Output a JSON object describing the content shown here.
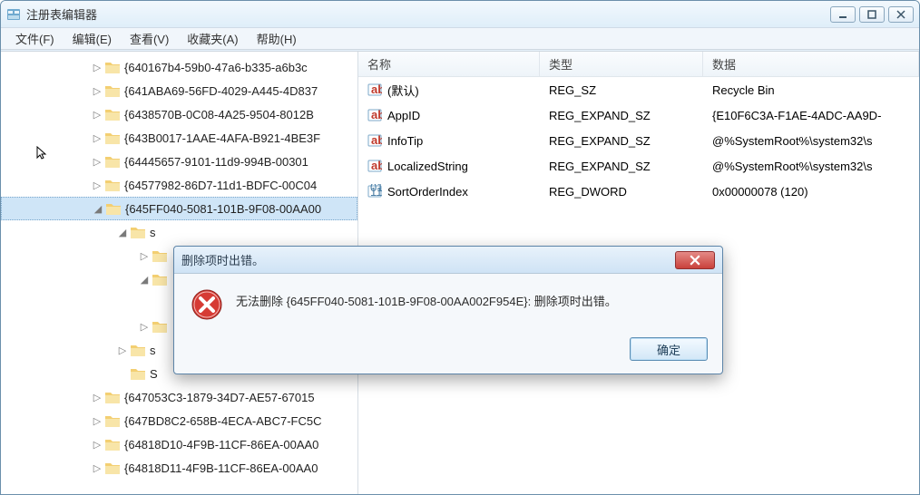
{
  "window": {
    "title": "注册表编辑器"
  },
  "menu": {
    "file": "文件(F)",
    "edit": "编辑(E)",
    "view": "查看(V)",
    "favorites": "收藏夹(A)",
    "help": "帮助(H)"
  },
  "tree": {
    "items": [
      {
        "indent": 100,
        "toggle": "▷",
        "label": "{640167b4-59b0-47a6-b335-a6b3c",
        "selected": false
      },
      {
        "indent": 100,
        "toggle": "▷",
        "label": "{641ABA69-56FD-4029-A445-4D837",
        "selected": false
      },
      {
        "indent": 100,
        "toggle": "▷",
        "label": "{6438570B-0C08-4A25-9504-8012B",
        "selected": false
      },
      {
        "indent": 100,
        "toggle": "▷",
        "label": "{643B0017-1AAE-4AFA-B921-4BE3F",
        "selected": false
      },
      {
        "indent": 100,
        "toggle": "▷",
        "label": "{64445657-9101-11d9-994B-00301",
        "selected": false
      },
      {
        "indent": 100,
        "toggle": "▷",
        "label": "{64577982-86D7-11d1-BDFC-00C04",
        "selected": false
      },
      {
        "indent": 100,
        "toggle": "◢",
        "label": "{645FF040-5081-101B-9F08-00AA00",
        "selected": true
      },
      {
        "indent": 128,
        "toggle": "◢",
        "label": "s",
        "selected": false
      },
      {
        "indent": 152,
        "toggle": "▷",
        "label": "",
        "selected": false
      },
      {
        "indent": 152,
        "toggle": "◢",
        "label": "",
        "selected": false
      },
      {
        "indent": 176,
        "toggle": "",
        "label": "",
        "selected": false
      },
      {
        "indent": 152,
        "toggle": "▷",
        "label": "",
        "selected": false
      },
      {
        "indent": 128,
        "toggle": "▷",
        "label": "s",
        "selected": false
      },
      {
        "indent": 128,
        "toggle": "",
        "label": "S",
        "selected": false
      },
      {
        "indent": 100,
        "toggle": "▷",
        "label": "{647053C3-1879-34D7-AE57-67015",
        "selected": false
      },
      {
        "indent": 100,
        "toggle": "▷",
        "label": "{647BD8C2-658B-4ECA-ABC7-FC5C",
        "selected": false
      },
      {
        "indent": 100,
        "toggle": "▷",
        "label": "{64818D10-4F9B-11CF-86EA-00AA0",
        "selected": false
      },
      {
        "indent": 100,
        "toggle": "▷",
        "label": "{64818D11-4F9B-11CF-86EA-00AA0",
        "selected": false
      }
    ]
  },
  "list": {
    "headers": {
      "name": "名称",
      "type": "类型",
      "data": "数据"
    },
    "rows": [
      {
        "icon": "ab",
        "name": "(默认)",
        "type": "REG_SZ",
        "data": "Recycle Bin"
      },
      {
        "icon": "ab",
        "name": "AppID",
        "type": "REG_EXPAND_SZ",
        "data": "{E10F6C3A-F1AE-4ADC-AA9D-"
      },
      {
        "icon": "ab",
        "name": "InfoTip",
        "type": "REG_EXPAND_SZ",
        "data": "@%SystemRoot%\\system32\\s"
      },
      {
        "icon": "ab",
        "name": "LocalizedString",
        "type": "REG_EXPAND_SZ",
        "data": "@%SystemRoot%\\system32\\s"
      },
      {
        "icon": "bin",
        "name": "SortOrderIndex",
        "type": "REG_DWORD",
        "data": "0x00000078 (120)"
      }
    ]
  },
  "dialog": {
    "title": "删除项时出错。",
    "message": "无法删除 {645FF040-5081-101B-9F08-00AA002F954E}: 删除项时出错。",
    "ok": "确定"
  }
}
